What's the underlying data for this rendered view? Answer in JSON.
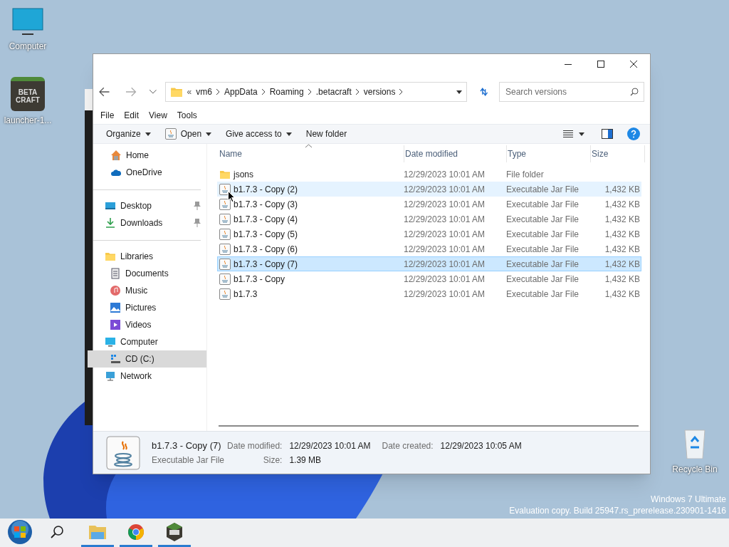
{
  "desktop_icons": [
    {
      "label": "Computer",
      "kind": "monitor"
    },
    {
      "label": "launcher-1...",
      "kind": "betacraft",
      "logo_text": [
        "BETA",
        "CRAFT"
      ]
    }
  ],
  "recycle_bin": {
    "label": "Recycle Bin"
  },
  "watermark": [
    "Windows 7 Ultimate",
    "Evaluation copy. Build 25947.rs_prerelease.230901-1416"
  ],
  "explorer": {
    "address": {
      "overflow": "«",
      "crumbs": [
        "vm6",
        "AppData",
        "Roaming",
        ".betacraft",
        "versions"
      ]
    },
    "search": {
      "placeholder": "Search versions"
    },
    "menu": [
      "File",
      "Edit",
      "View",
      "Tools"
    ],
    "toolbar": [
      {
        "label": "Organize",
        "kind": "plain",
        "dropdown": true
      },
      {
        "label": "Open",
        "kind": "open",
        "dropdown": true
      },
      {
        "label": "Give access to",
        "kind": "plain",
        "dropdown": true
      },
      {
        "label": "New folder",
        "kind": "plain",
        "dropdown": false
      }
    ],
    "sidebar": {
      "groups": [
        [
          {
            "label": "Home",
            "kind": "home",
            "selected": false,
            "pinned": false
          },
          {
            "label": "OneDrive",
            "kind": "cloud",
            "selected": false,
            "pinned": false
          }
        ],
        [
          {
            "label": "Desktop",
            "kind": "desktop",
            "selected": false,
            "pinned": true
          },
          {
            "label": "Downloads",
            "kind": "download",
            "selected": false,
            "pinned": true
          }
        ],
        [
          {
            "label": "Libraries",
            "kind": "folder",
            "selected": false,
            "pinned": false,
            "children": [
              {
                "label": "Documents",
                "kind": "document",
                "selected": false,
                "pinned": false
              },
              {
                "label": "Music",
                "kind": "music",
                "selected": false,
                "pinned": false
              },
              {
                "label": "Pictures",
                "kind": "picture",
                "selected": false,
                "pinned": false
              },
              {
                "label": "Videos",
                "kind": "video",
                "selected": false,
                "pinned": false
              }
            ]
          },
          {
            "label": "Computer",
            "kind": "monitor",
            "selected": false,
            "pinned": false,
            "children": [
              {
                "label": "CD (C:)",
                "kind": "drive",
                "selected": true,
                "pinned": false
              }
            ]
          },
          {
            "label": "Network",
            "kind": "network",
            "selected": false,
            "pinned": false
          }
        ]
      ]
    },
    "table": {
      "columns": [
        "Name",
        "Date modified",
        "Type",
        "Size"
      ],
      "rows": [
        {
          "kind": "folder",
          "name": "jsons",
          "date": "12/29/2023 10:01 AM",
          "type": "File folder",
          "size": "",
          "selected": false,
          "hovered": false
        },
        {
          "kind": "jar",
          "name": "b1.7.3 - Copy (2)",
          "date": "12/29/2023 10:01 AM",
          "type": "Executable Jar File",
          "size": "1,432 KB",
          "selected": false,
          "hovered": true
        },
        {
          "kind": "jar",
          "name": "b1.7.3 - Copy (3)",
          "date": "12/29/2023 10:01 AM",
          "type": "Executable Jar File",
          "size": "1,432 KB",
          "selected": false,
          "hovered": false
        },
        {
          "kind": "jar",
          "name": "b1.7.3 - Copy (4)",
          "date": "12/29/2023 10:01 AM",
          "type": "Executable Jar File",
          "size": "1,432 KB",
          "selected": false,
          "hovered": false
        },
        {
          "kind": "jar",
          "name": "b1.7.3 - Copy (5)",
          "date": "12/29/2023 10:01 AM",
          "type": "Executable Jar File",
          "size": "1,432 KB",
          "selected": false,
          "hovered": false
        },
        {
          "kind": "jar",
          "name": "b1.7.3 - Copy (6)",
          "date": "12/29/2023 10:01 AM",
          "type": "Executable Jar File",
          "size": "1,432 KB",
          "selected": false,
          "hovered": false
        },
        {
          "kind": "jar",
          "name": "b1.7.3 - Copy (7)",
          "date": "12/29/2023 10:01 AM",
          "type": "Executable Jar File",
          "size": "1,432 KB",
          "selected": true,
          "hovered": false
        },
        {
          "kind": "jar",
          "name": "b1.7.3 - Copy",
          "date": "12/29/2023 10:01 AM",
          "type": "Executable Jar File",
          "size": "1,432 KB",
          "selected": false,
          "hovered": false
        },
        {
          "kind": "jar",
          "name": "b1.7.3",
          "date": "12/29/2023 10:01 AM",
          "type": "Executable Jar File",
          "size": "1,432 KB",
          "selected": false,
          "hovered": false
        }
      ]
    },
    "details": {
      "name": "b1.7.3 - Copy (7)",
      "type": "Executable Jar File",
      "fields": [
        {
          "label": "Date modified:",
          "value": "12/29/2023 10:01 AM"
        },
        {
          "label": "Date created:",
          "value": "12/29/2023 10:05 AM"
        },
        {
          "label": "Size:",
          "value": "1.39 MB"
        }
      ]
    }
  },
  "taskbar": [
    {
      "kind": "start",
      "running": false
    },
    {
      "kind": "search",
      "running": false
    },
    {
      "kind": "explorer",
      "running": true
    },
    {
      "kind": "chrome",
      "running": true
    },
    {
      "kind": "betacraft",
      "running": true
    }
  ]
}
